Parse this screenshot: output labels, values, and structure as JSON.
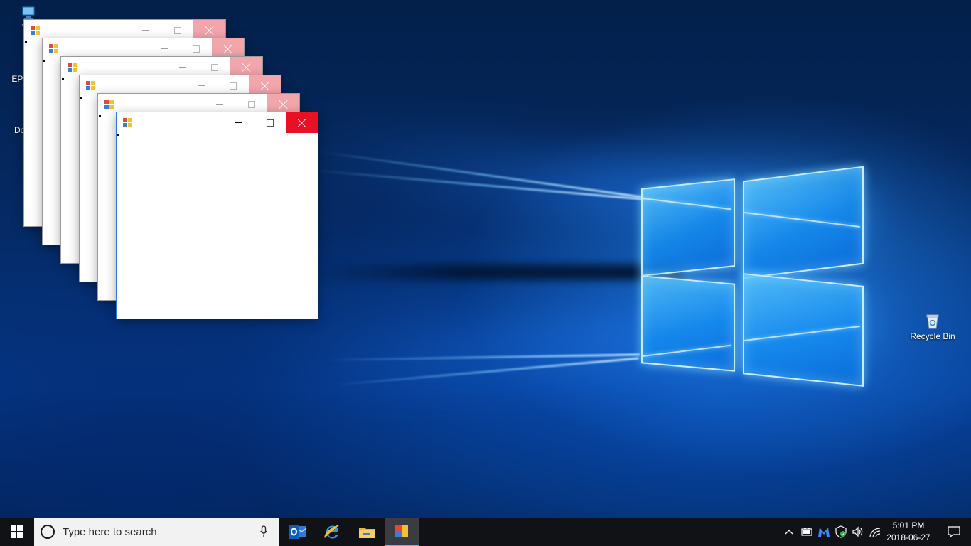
{
  "desktop": {
    "icons": [
      {
        "name": "this-pc",
        "label": "Thi"
      },
      {
        "name": "epson",
        "label": "EPSO"
      },
      {
        "name": "documents",
        "label": "Docu"
      },
      {
        "name": "recycle-bin",
        "label": "Recycle Bin"
      }
    ]
  },
  "windows": [
    {
      "id": 1,
      "title": "",
      "state": "inactive"
    },
    {
      "id": 2,
      "title": "",
      "state": "inactive"
    },
    {
      "id": 3,
      "title": "",
      "state": "inactive"
    },
    {
      "id": 4,
      "title": "",
      "state": "inactive"
    },
    {
      "id": 5,
      "title": "",
      "state": "inactive"
    },
    {
      "id": 6,
      "title": "",
      "state": "active"
    }
  ],
  "taskbar": {
    "search": {
      "placeholder": "Type here to search"
    },
    "pinned_apps": [
      "outlook-icon",
      "internet-explorer-icon",
      "file-explorer-icon",
      "winforms-app-icon"
    ],
    "clock": {
      "time": "5:01 PM",
      "date": "2018-06-27"
    }
  },
  "colors": {
    "taskbar": "#101216",
    "close_active": "#e81123",
    "close_inactive": "#f1a6ac",
    "window_border_active": "#2b79d8"
  }
}
